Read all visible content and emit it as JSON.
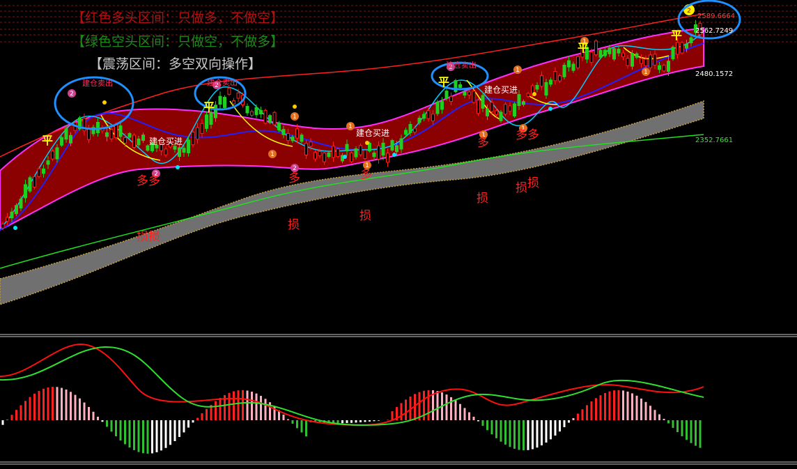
{
  "legend": {
    "bull": "【红色多头区间：只做多，不做空】",
    "bear": "【绿色空头区间：只做空，不做多】",
    "range": "【震荡区间：多空双向操作】",
    "bull_color": "#d01818",
    "bear_color": "#1e9e1e",
    "range_color": "#c8c8c8"
  },
  "price_labels": {
    "top": "2589.6664",
    "mid": "2562.7249",
    "band_low": "2480.1572",
    "green_ma": "2352.7661"
  },
  "annotations": {
    "sell": "建仓卖出",
    "buy": "建仓买进",
    "close": "平",
    "long": "多",
    "loss": "损",
    "double_long": "多多",
    "double_loss": "损损"
  },
  "chart_data": {
    "type": "candlestick",
    "main_panel": {
      "y_labels_visible": [
        "2589.6664",
        "2562.7249",
        "2480.1572",
        "2352.7661"
      ],
      "series": [
        {
          "color": "#ff2020"
        },
        {
          "color": "#ff30ff"
        },
        {
          "color": "#2020ff"
        },
        {
          "color": "#00d0ff"
        },
        {
          "color": "#ffff00"
        },
        {
          "color": "#20e020"
        },
        {
          "color": "#808080"
        }
      ]
    },
    "sub_panel": {
      "type": "macd",
      "series": [
        {
          "color": "#ff1010"
        },
        {
          "color": "#30e030"
        }
      ]
    }
  }
}
